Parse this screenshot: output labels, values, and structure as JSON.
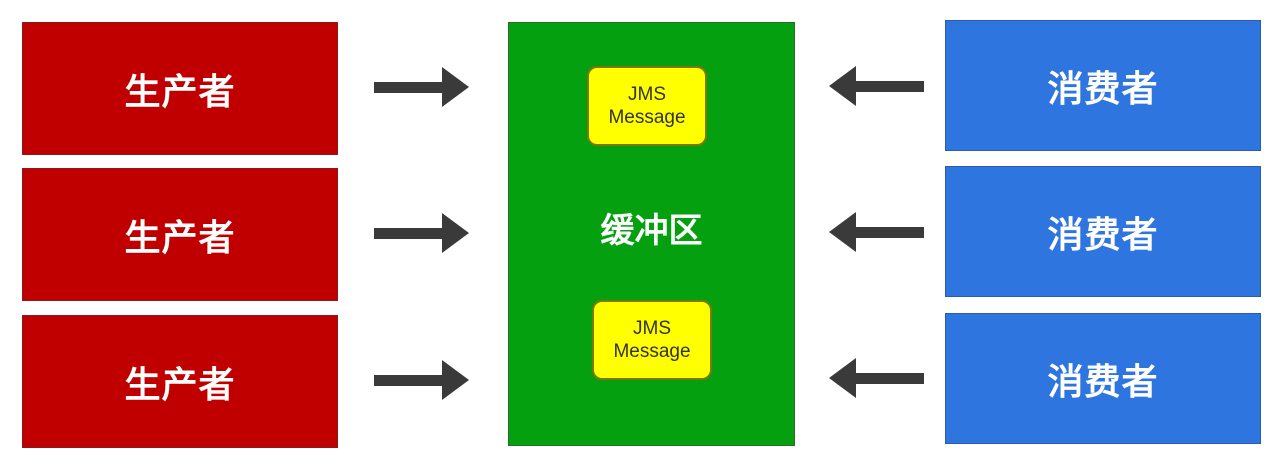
{
  "producers": [
    {
      "label": "生产者"
    },
    {
      "label": "生产者"
    },
    {
      "label": "生产者"
    }
  ],
  "buffer": {
    "label": "缓冲区",
    "messages": [
      {
        "line1": "JMS",
        "line2": "Message"
      },
      {
        "line1": "JMS",
        "line2": "Message"
      }
    ]
  },
  "consumers": [
    {
      "label": "消费者"
    },
    {
      "label": "消费者"
    },
    {
      "label": "消费者"
    }
  ],
  "colors": {
    "producer": "#c00000",
    "consumer": "#2e75e0",
    "buffer": "#05a010",
    "message": "#ffff00",
    "arrow": "#3a3a3a"
  }
}
